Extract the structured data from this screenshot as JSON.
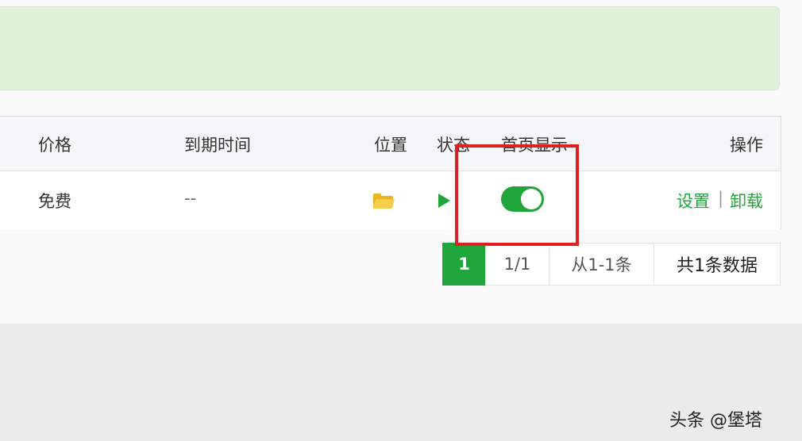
{
  "table": {
    "headers": {
      "price": "价格",
      "expire": "到期时间",
      "location": "位置",
      "status": "状态",
      "home_display": "首页显示",
      "actions": "操作"
    },
    "rows": [
      {
        "price": "免费",
        "expire": "--",
        "location_icon": "folder-icon",
        "status_icon": "play-icon",
        "home_display_enabled": true,
        "actions": {
          "settings": "设置",
          "separator": "|",
          "uninstall": "卸载"
        }
      }
    ]
  },
  "pagination": {
    "current_page": "1",
    "page_ratio": "1/1",
    "range": "从1-1条",
    "total": "共1条数据"
  },
  "watermark": "头条 @堡塔",
  "colors": {
    "accent": "#20a53a",
    "notice_bg": "#dff0d8",
    "highlight_border": "#e02020",
    "folder": "#f0c43a"
  }
}
